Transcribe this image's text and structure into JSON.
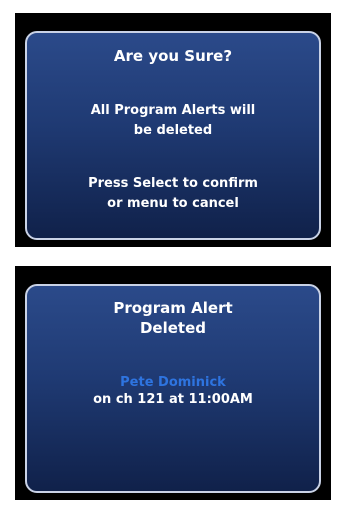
{
  "confirm_dialog": {
    "title": "Are you Sure?",
    "message_line1": "All Program Alerts will",
    "message_line2": "be deleted",
    "hint_line1": "Press Select to confirm",
    "hint_line2": "or menu to cancel"
  },
  "result_dialog": {
    "title_line1": "Program Alert",
    "title_line2": "Deleted",
    "program_name": "Pete Dominick",
    "channel_time": "on ch 121 at 11:00AM"
  },
  "colors": {
    "dialog_gradient_top": "#2b4a8a",
    "dialog_gradient_bottom": "#10214a",
    "border": "#c9d2e6",
    "program_name": "#2e74e0",
    "text": "#ffffff",
    "screen_bg": "#000000"
  }
}
